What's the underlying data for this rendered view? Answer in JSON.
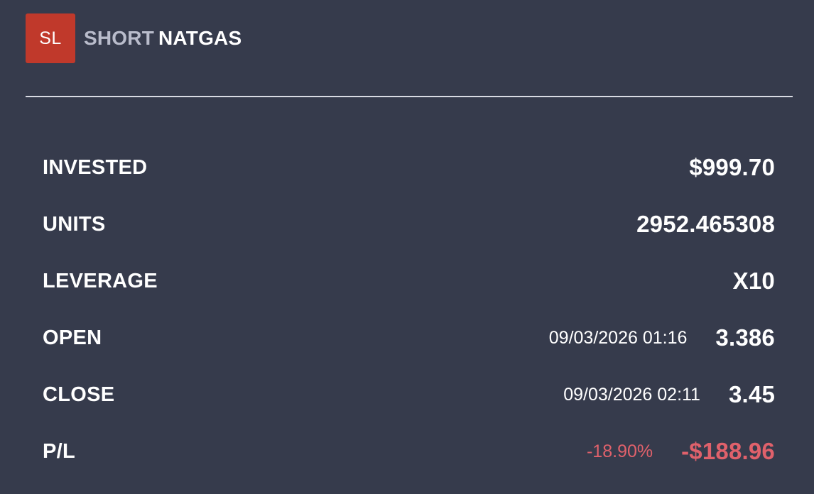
{
  "header": {
    "badge": "SL",
    "direction": "SHORT",
    "symbol": "NATGAS"
  },
  "details": {
    "invested": {
      "label": "INVESTED",
      "value": "$999.70"
    },
    "units": {
      "label": "UNITS",
      "value": "2952.465308"
    },
    "leverage": {
      "label": "LEVERAGE",
      "value": "X10"
    },
    "open": {
      "label": "OPEN",
      "timestamp": "09/03/2026 01:16",
      "value": "3.386"
    },
    "close": {
      "label": "CLOSE",
      "timestamp": "09/03/2026 02:11",
      "value": "3.45"
    },
    "pl": {
      "label": "P/L",
      "percent": "-18.90%",
      "value": "-$188.96"
    }
  },
  "colors": {
    "background": "#363b4c",
    "badge": "#c0392b",
    "negative": "#e0616b",
    "direction_text": "#b9bccb"
  }
}
